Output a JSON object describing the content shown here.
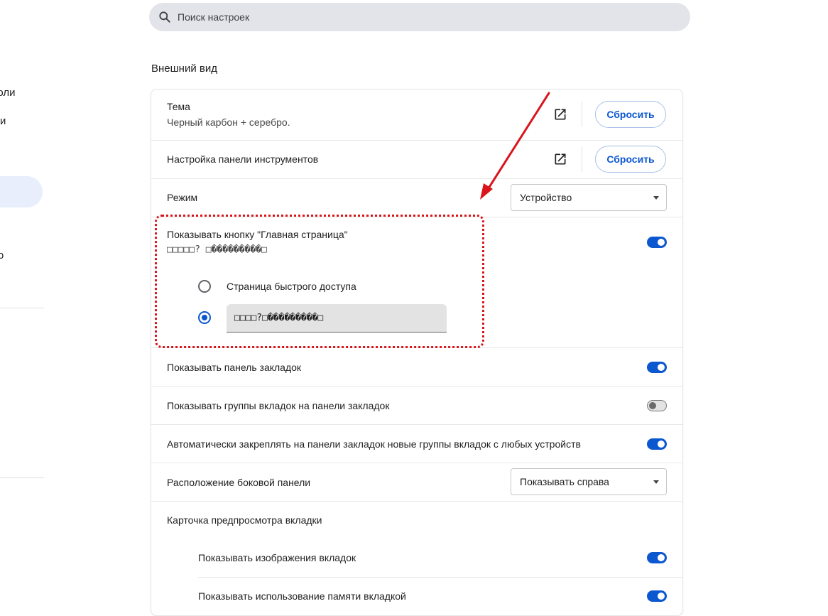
{
  "sidebar": {
    "fragment_1": "роли",
    "fragment_2": "и",
    "fragment_3": "ю"
  },
  "search": {
    "placeholder": "Поиск настроек"
  },
  "section": {
    "title": "Внешний вид"
  },
  "settings": {
    "theme": {
      "label": "Тема",
      "value": "Черный карбон + серебро.",
      "reset_label": "Сбросить"
    },
    "toolbar": {
      "label": "Настройка панели инструментов",
      "reset_label": "Сбросить"
    },
    "mode": {
      "label": "Режим",
      "selected": "Устройство"
    },
    "home_button": {
      "label": "Показывать кнопку \"Главная страница\"",
      "sub": "□□□□□? □���������□",
      "enabled": true,
      "options": [
        {
          "label": "Страница быстрого доступа",
          "selected": false
        },
        {
          "value": "□□□□?□���������□",
          "selected": true
        }
      ]
    },
    "bookmarks_bar": {
      "label": "Показывать панель закладок",
      "enabled": true
    },
    "tab_groups_bookmarks": {
      "label": "Показывать группы вкладок на панели закладок",
      "enabled": false
    },
    "auto_pin_groups": {
      "label": "Автоматически закреплять на панели закладок новые группы вкладок с любых устройств",
      "enabled": true
    },
    "side_panel": {
      "label": "Расположение боковой панели",
      "selected": "Показывать справа"
    },
    "tab_preview": {
      "label": "Карточка предпросмотра вкладки",
      "show_images": {
        "label": "Показывать изображения вкладок",
        "enabled": true
      },
      "show_memory": {
        "label": "Показывать использование памяти вкладкой",
        "enabled": true
      }
    }
  },
  "colors": {
    "accent": "#0b57d0",
    "annotation": "#d9141b",
    "search_bg": "#e3e4ea"
  }
}
